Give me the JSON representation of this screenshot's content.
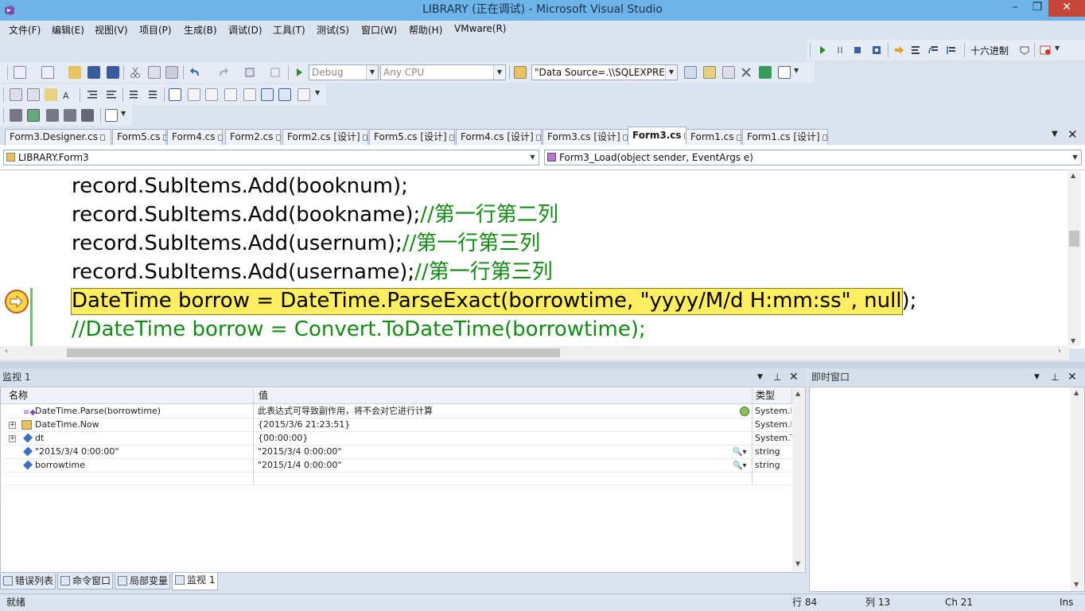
{
  "window": {
    "title": "LIBRARY (正在调试) - Microsoft Visual Studio",
    "minimize": "–",
    "maximize": "❐",
    "close": "✕"
  },
  "menu": [
    "文件(F)",
    "编辑(E)",
    "视图(V)",
    "项目(P)",
    "生成(B)",
    "调试(D)",
    "工具(T)",
    "测试(S)",
    "窗口(W)",
    "帮助(H)",
    "VMware(R)"
  ],
  "debug_toolbar": {
    "hex_label": "十六进制"
  },
  "standard_toolbar": {
    "config": "Debug",
    "platform": "Any CPU",
    "connection": "\"Data Source=.\\\\SQLEXPRES"
  },
  "tabs": [
    {
      "label": "Form3.Designer.cs",
      "active": false
    },
    {
      "label": "Form5.cs",
      "active": false
    },
    {
      "label": "Form4.cs",
      "active": false
    },
    {
      "label": "Form2.cs",
      "active": false
    },
    {
      "label": "Form2.cs [设计]",
      "active": false
    },
    {
      "label": "Form5.cs [设计]",
      "active": false
    },
    {
      "label": "Form4.cs [设计]",
      "active": false
    },
    {
      "label": "Form3.cs [设计]",
      "active": false
    },
    {
      "label": "Form3.cs",
      "active": true
    },
    {
      "label": "Form1.cs",
      "active": false
    },
    {
      "label": "Form1.cs [设计]",
      "active": false
    }
  ],
  "navbar": {
    "class_selector": "LIBRARY.Form3",
    "member_selector": "Form3_Load(object sender, EventArgs e)"
  },
  "code": [
    {
      "code": "record.SubItems.Add(booknum);",
      "comment": ""
    },
    {
      "code": "record.SubItems.Add(bookname);",
      "comment": "//第一行第二列"
    },
    {
      "code": "record.SubItems.Add(usernum);",
      "comment": "//第一行第三列"
    },
    {
      "code": "record.SubItems.Add(username);",
      "comment": "//第一行第三列"
    },
    {
      "code": "DateTime borrow = DateTime.ParseExact(borrowtime, \"yyyy/M/d H:mm:ss\", null);",
      "comment": ""
    },
    {
      "code": "",
      "comment": "//DateTime borrow = Convert.ToDateTime(borrowtime);"
    }
  ],
  "watch": {
    "title": "监视 1",
    "columns": {
      "name": "名称",
      "value": "值",
      "type": "类型"
    },
    "rows": [
      {
        "name": "DateTime.Parse(borrowtime)",
        "value": "此表达式可导致副作用，将不会对它进行计算",
        "type": "System.D",
        "expand": ""
      },
      {
        "name": "DateTime.Now",
        "value": "{2015/3/6 21:23:51}",
        "type": "System.D",
        "expand": "+"
      },
      {
        "name": "dt",
        "value": "{00:00:00}",
        "type": "System.T",
        "expand": "+"
      },
      {
        "name": "\"2015/3/4 0:00:00\"",
        "value": "\"2015/3/4 0:00:00\"",
        "type": "string",
        "expand": ""
      },
      {
        "name": "borrowtime",
        "value": "\"2015/1/4 0:00:00\"",
        "type": "string",
        "expand": ""
      }
    ]
  },
  "immediate": {
    "title": "即时窗口"
  },
  "bottom_tabs": [
    {
      "label": "错误列表",
      "active": false
    },
    {
      "label": "命令窗口",
      "active": false
    },
    {
      "label": "局部变量",
      "active": false
    },
    {
      "label": "监视 1",
      "active": true
    }
  ],
  "status": {
    "ready": "就绪",
    "line": "行 84",
    "col": "列 13",
    "ch": "Ch 21",
    "mode": "Ins"
  },
  "colors": {
    "accent": "#6db4e8",
    "comment": "#138a13",
    "highlight": "#ffee62"
  }
}
